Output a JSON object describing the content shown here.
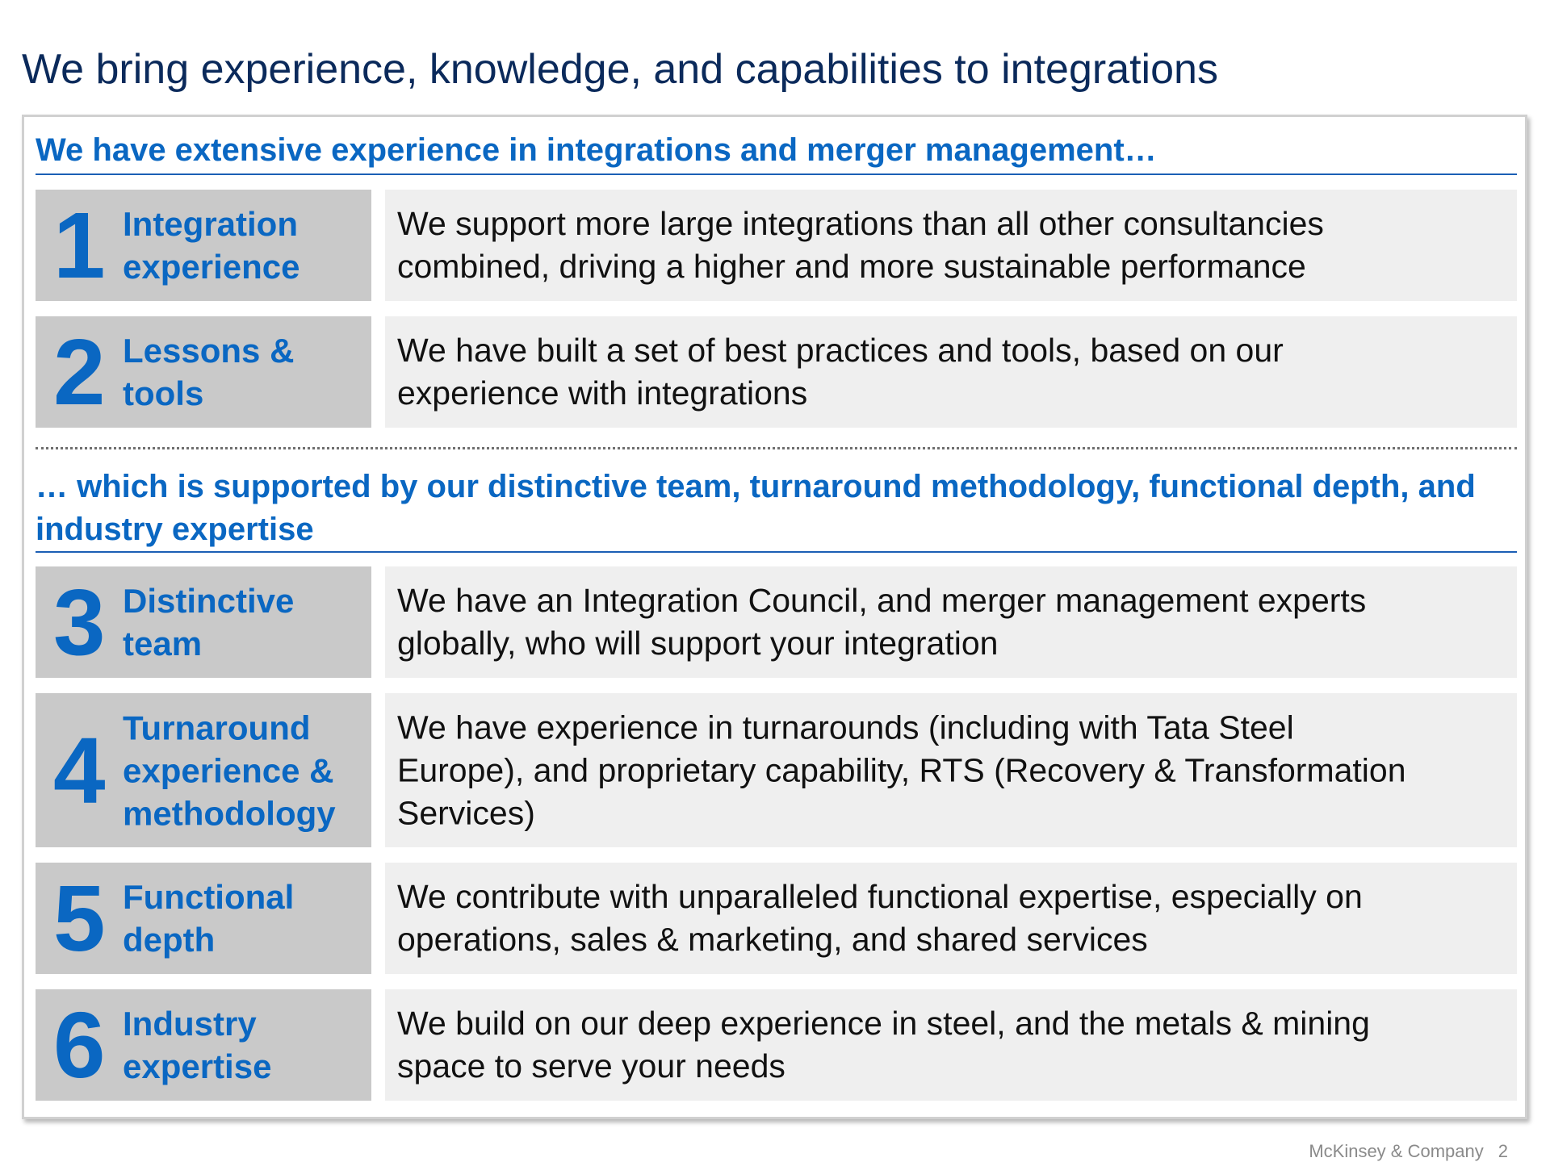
{
  "title": "We bring experience, knowledge, and capabilities to integrations",
  "colors": {
    "title": "#0b2a5b",
    "accent": "#0a67c2",
    "label_box": "#c9c9c9",
    "desc_box": "#efefef"
  },
  "sections": [
    {
      "heading": "We have extensive experience in integrations and merger management…",
      "rows": [
        {
          "number": "1",
          "label": "Integration\nexperience",
          "description": "We support more large integrations than all other consultancies\ncombined, driving a higher and more sustainable performance"
        },
        {
          "number": "2",
          "label": "Lessons &\ntools",
          "description": "We have built a set of best practices and tools, based on our\nexperience with integrations"
        }
      ]
    },
    {
      "heading": "… which is supported by our distinctive team, turnaround methodology, functional depth, and industry expertise",
      "rows": [
        {
          "number": "3",
          "label": "Distinctive\nteam",
          "description": "We have an Integration Council, and merger management experts\nglobally, who will support your integration"
        },
        {
          "number": "4",
          "label": "Turnaround\nexperience &\nmethodology",
          "description": "We have experience in turnarounds (including with Tata Steel\nEurope), and proprietary capability, RTS (Recovery & Transformation\nServices)"
        },
        {
          "number": "5",
          "label": "Functional\ndepth",
          "description": "We contribute with unparalleled functional expertise, especially on\noperations, sales & marketing, and shared services"
        },
        {
          "number": "6",
          "label": "Industry\nexpertise",
          "description": "We build on our deep experience in steel, and the metals & mining\nspace to serve your needs"
        }
      ]
    }
  ],
  "footer": {
    "company": "McKinsey & Company",
    "page": "2"
  }
}
